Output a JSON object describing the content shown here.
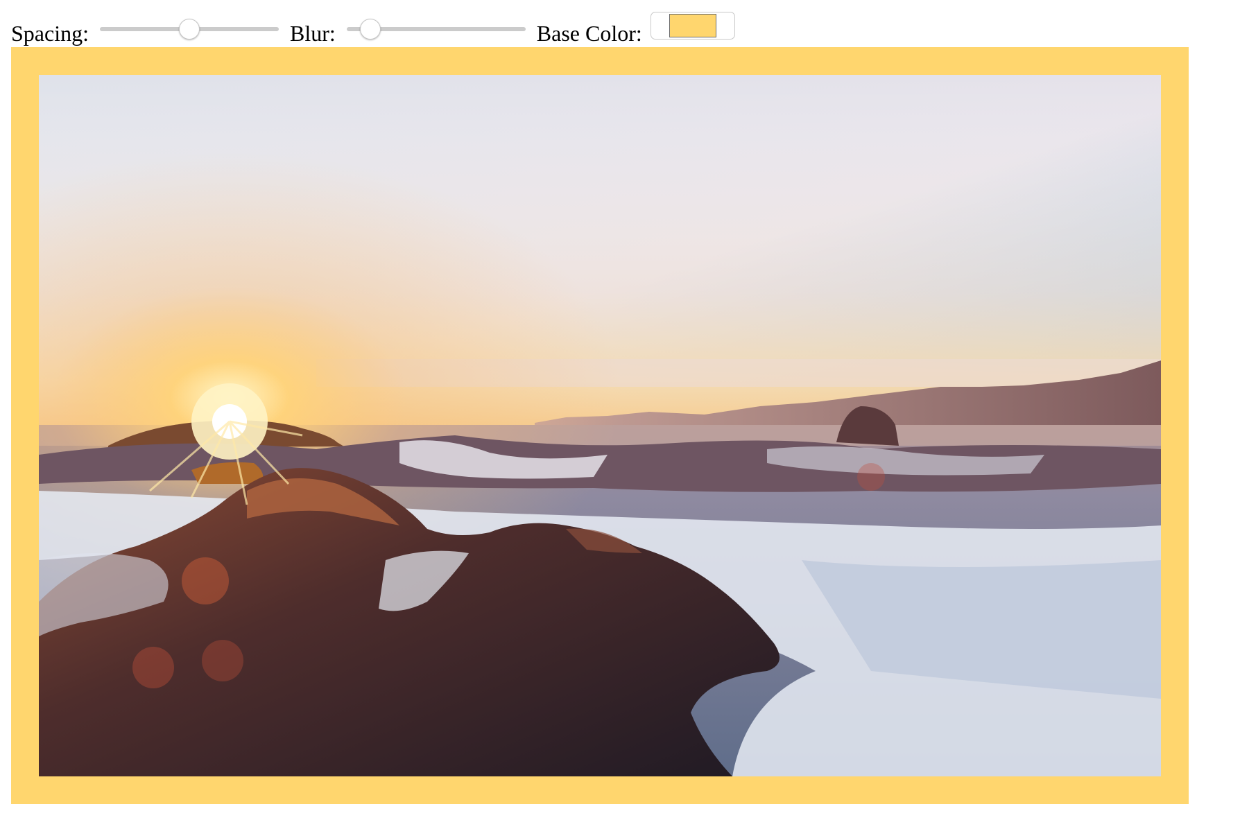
{
  "controls": {
    "spacing_label": "Spacing:",
    "spacing_value": 0.5,
    "blur_label": "Blur:",
    "blur_value": 0.1,
    "base_color_label": "Base Color:",
    "base_color": "#ffd66e"
  },
  "photo": {
    "subject": "ocean-sunset-rocks-image",
    "colors": {
      "sky_top": "#dfe2ea",
      "sky_right": "#8ab4d1",
      "horizon": "#f7e2c0",
      "sun": "#ffd37a",
      "water": "#7b87a2",
      "foam": "#e8ecf4",
      "rock": "#4a2c2c"
    }
  }
}
